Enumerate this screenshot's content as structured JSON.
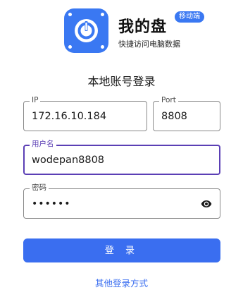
{
  "app": {
    "name": "我的盘",
    "badge": "移动端",
    "subtitle": "快捷访问电脑数据",
    "logo_icon": "power-icon",
    "accent_color": "#3a78f2"
  },
  "form": {
    "title": "本地账号登录",
    "ip": {
      "label": "IP",
      "value": "172.16.10.184"
    },
    "port": {
      "label": "Port",
      "value": "8808"
    },
    "username": {
      "label": "用户名",
      "value": "wodepan8808"
    },
    "password": {
      "label": "密码",
      "value": "••••••",
      "toggle_icon": "eye-icon"
    },
    "focused_field": "username",
    "focus_color": "#5b3fb5"
  },
  "actions": {
    "login_label": "登 录",
    "login_color": "#3a6ef0",
    "other_methods_label": "其他登录方式"
  }
}
